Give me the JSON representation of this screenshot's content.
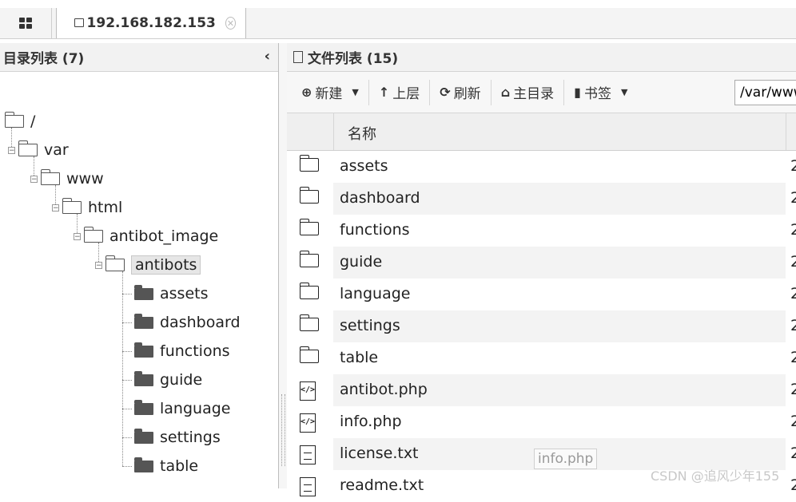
{
  "tabs": {
    "host_label": "192.168.182.153"
  },
  "left_panel": {
    "title": "目录列表 (7)"
  },
  "tree": {
    "root": "/",
    "var": "var",
    "www": "www",
    "html": "html",
    "antibot_image": "antibot_image",
    "antibots": "antibots",
    "children": [
      "assets",
      "dashboard",
      "functions",
      "guide",
      "language",
      "settings",
      "table"
    ]
  },
  "right_panel": {
    "title": "文件列表 (15)",
    "toolbar": {
      "new_label": "新建",
      "up_label": "上层",
      "refresh_label": "刷新",
      "home_label": "主目录",
      "bookmark_label": "书签",
      "path_value": "/var/www"
    },
    "column_name": "名称",
    "files": [
      {
        "name": "assets",
        "kind": "folder",
        "trail": "2"
      },
      {
        "name": "dashboard",
        "kind": "folder",
        "trail": "2"
      },
      {
        "name": "functions",
        "kind": "folder",
        "trail": "2"
      },
      {
        "name": "guide",
        "kind": "folder",
        "trail": "2"
      },
      {
        "name": "language",
        "kind": "folder",
        "trail": "2"
      },
      {
        "name": "settings",
        "kind": "folder",
        "trail": "2"
      },
      {
        "name": "table",
        "kind": "folder",
        "trail": "2"
      },
      {
        "name": "antibot.php",
        "kind": "code",
        "trail": "2"
      },
      {
        "name": "info.php",
        "kind": "code",
        "trail": "2"
      },
      {
        "name": "license.txt",
        "kind": "text",
        "trail": "2"
      },
      {
        "name": "readme.txt",
        "kind": "text",
        "trail": "2"
      }
    ]
  },
  "tooltip": "info.php",
  "watermark": "CSDN @追风少年155"
}
